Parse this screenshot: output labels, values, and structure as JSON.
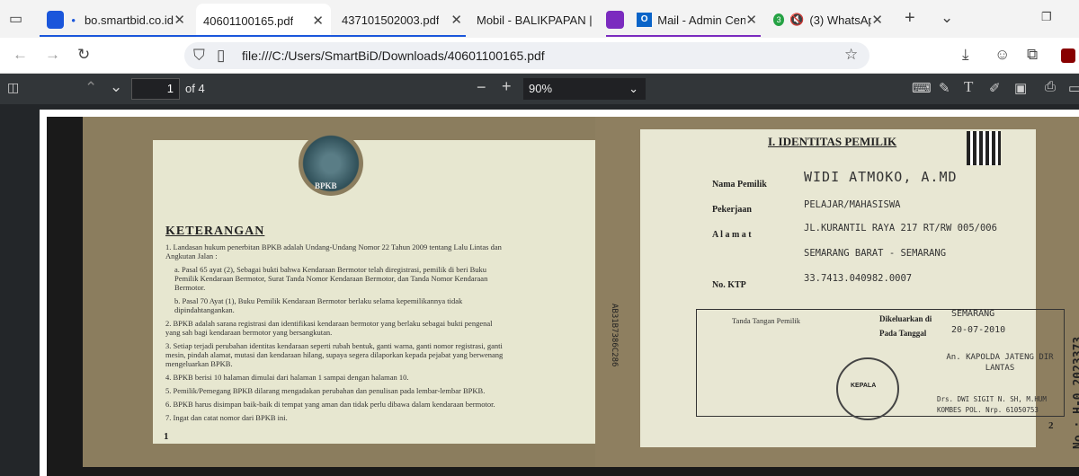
{
  "tabs": [
    {
      "title": "bo.smartbid.co.id/",
      "color": "#1a56db",
      "dot": "•"
    },
    {
      "title": "40601100165.pdf",
      "active": true
    },
    {
      "title": "437101502003.pdf"
    },
    {
      "title": "Mobil - BALIKPAPAN |"
    },
    {
      "title": "Mail - Admin Cent",
      "color": "#7b2bbf"
    },
    {
      "title": "(3) WhatsApp",
      "badge": "3"
    }
  ],
  "address": {
    "url": "file:///C:/Users/SmartBiD/Downloads/40601100165.pdf"
  },
  "pdf_toolbar": {
    "page_current": "1",
    "page_total": "of 4",
    "zoom": "90%"
  },
  "document": {
    "left_page": {
      "seal_text": "BPKB",
      "heading": "KETERANGAN",
      "items": [
        "1. Landasan hukum penerbitan BPKB adalah Undang-Undang Nomor 22 Tahun 2009 tentang Lalu Lintas dan Angkutan Jalan :",
        "a. Pasal 65 ayat (2), Sebagai bukti bahwa Kendaraan Bermotor telah diregistrasi, pemilik di beri Buku Pemilik Kendaraan Bermotor, Surat Tanda Nomor Kendaraan Bermotor, dan Tanda Nomor Kendaraan Bermotor.",
        "b. Pasal 70 Ayat (1), Buku Pemilik Kendaraan Bermotor berlaku selama kepemilikannya tidak dipindahtangankan.",
        "2. BPKB adalah sarana registrasi dan identifikasi kendaraan bermotor yang berlaku sebagai bukti pengenal yang sah bagi kendaraan bermotor yang bersangkutan.",
        "3. Setiap terjadi perubahan identitas kendaraan seperti rubah bentuk, ganti warna, ganti nomor registrasi, ganti mesin, pindah alamat, mutasi dan kendaraan hilang, supaya segera dilaporkan kepada pejabat yang berwenang mengeluarkan BPKB.",
        "4. BPKB berisi 10 halaman dimulai dari halaman 1 sampai dengan halaman 10.",
        "5. Pemilik/Pemegang BPKB dilarang mengadakan perubahan dan penulisan pada lembar-lembar BPKB.",
        "6. BPKB harus disimpan baik-baik di tempat yang aman dan tidak perlu dibawa dalam kendaraan bermotor.",
        "7. Ingat dan catat nomor dari BPKB ini."
      ],
      "page_no": "1"
    },
    "right_page": {
      "heading": "I.  IDENTITAS PEMILIK",
      "fields": [
        {
          "label": "Nama Pemilik",
          "value": "WIDI ATMOKO, A.MD"
        },
        {
          "label": "Pekerjaan",
          "value": "PELAJAR/MAHASISWA"
        },
        {
          "label": "A l a m a t",
          "value": "JL.KURANTIL RAYA 217 RT/RW 005/006"
        },
        {
          "label": "",
          "value": "SEMARANG BARAT - SEMARANG"
        },
        {
          "label": "No. KTP",
          "value": "33.7413.040982.0007"
        }
      ],
      "sig_label": "Tanda Tangan Pemilik",
      "issued_label": "Dikeluarkan di",
      "issued_value": "SEMARANG",
      "date_label": "Pada Tanggal",
      "date_value": "20-07-2010",
      "authority": "An. KAPOLDA JATENG DIR LANTAS",
      "official": "Drs. DWI SIGIT N. SH, M.HUM",
      "official_id": "KOMBES POL. Nrp. 61050753",
      "stamp_text": "KEPALA",
      "vertical_code": "AB31B7386C286",
      "serial": "No.: H-0 2023373",
      "page_no": "2"
    }
  }
}
